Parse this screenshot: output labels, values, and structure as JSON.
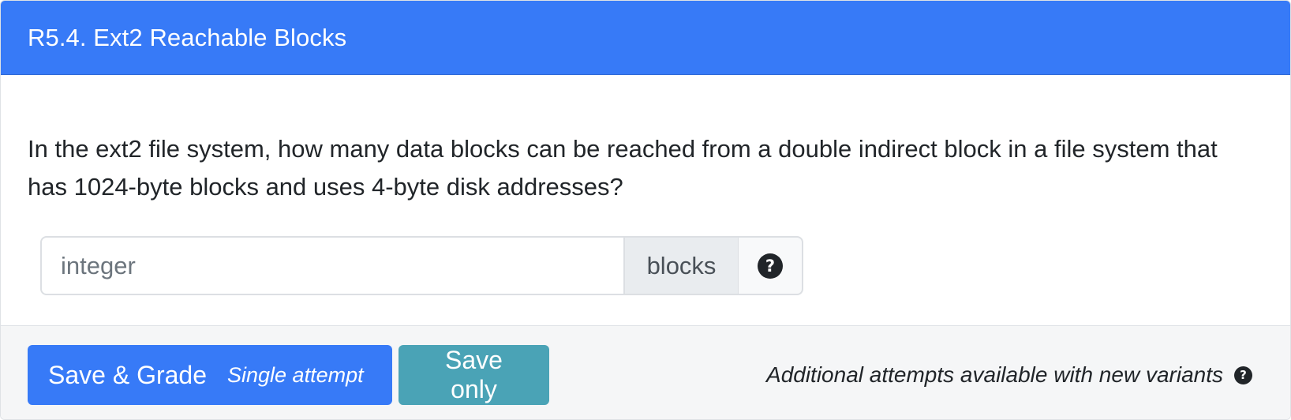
{
  "header": {
    "title": "R5.4. Ext2 Reachable Blocks",
    "bg_color": "#377af7"
  },
  "question": {
    "text": "In the ext2 file system, how many data blocks can be reached from a double indirect block in a file system that has 1024-byte blocks and uses 4-byte disk addresses?"
  },
  "answer": {
    "value": "",
    "placeholder": "integer",
    "units_label": "blocks",
    "help_icon": "question-circle-icon"
  },
  "footer": {
    "grade_button_label": "Save & Grade",
    "grade_button_attempt": "Single attempt",
    "save_button_label": "Save only",
    "attempts_text": "Additional attempts available with new variants",
    "attempts_help_icon": "question-circle-icon",
    "grade_color": "#377af7",
    "save_color": "#4aa3b6"
  }
}
